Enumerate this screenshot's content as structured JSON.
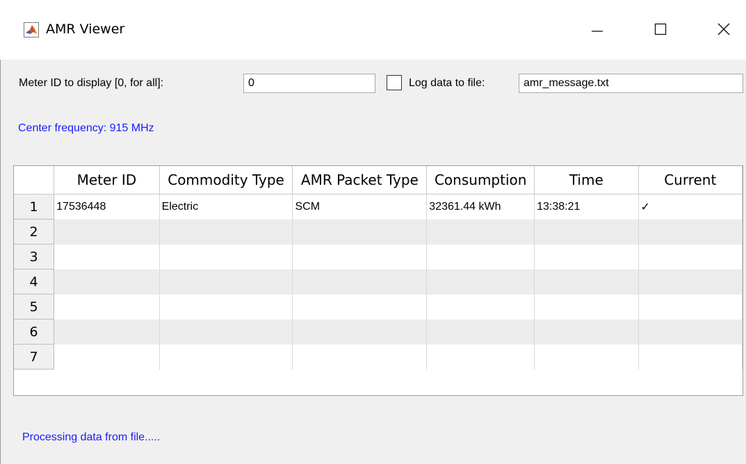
{
  "window": {
    "title": "AMR Viewer",
    "icon": "matlab-icon",
    "controls": [
      "minimize-icon",
      "maximize-icon",
      "close-icon"
    ]
  },
  "filter": {
    "meter_label": "Meter ID to display [0, for all]:",
    "meter_value": "0",
    "log_checked": false,
    "log_label": "Log data to file:",
    "log_file": "amr_message.txt"
  },
  "center_frequency": "Center frequency: 915 MHz",
  "table": {
    "columns": [
      "Meter ID",
      "Commodity Type",
      "AMR Packet Type",
      "Consumption",
      "Time",
      "Current"
    ],
    "row_numbers": [
      "1",
      "2",
      "3",
      "4",
      "5",
      "6",
      "7"
    ],
    "rows": [
      [
        "17536448",
        "Electric",
        "SCM",
        "32361.44 kWh",
        "13:38:21",
        "✓"
      ],
      [
        "",
        "",
        "",
        "",
        "",
        ""
      ],
      [
        "",
        "",
        "",
        "",
        "",
        ""
      ],
      [
        "",
        "",
        "",
        "",
        "",
        ""
      ],
      [
        "",
        "",
        "",
        "",
        "",
        ""
      ],
      [
        "",
        "",
        "",
        "",
        "",
        ""
      ],
      [
        "",
        "",
        "",
        "",
        "",
        ""
      ]
    ]
  },
  "status": "Processing data from file.....",
  "colors": {
    "status_text": "#1a1aff",
    "stripe": "#ececec"
  }
}
